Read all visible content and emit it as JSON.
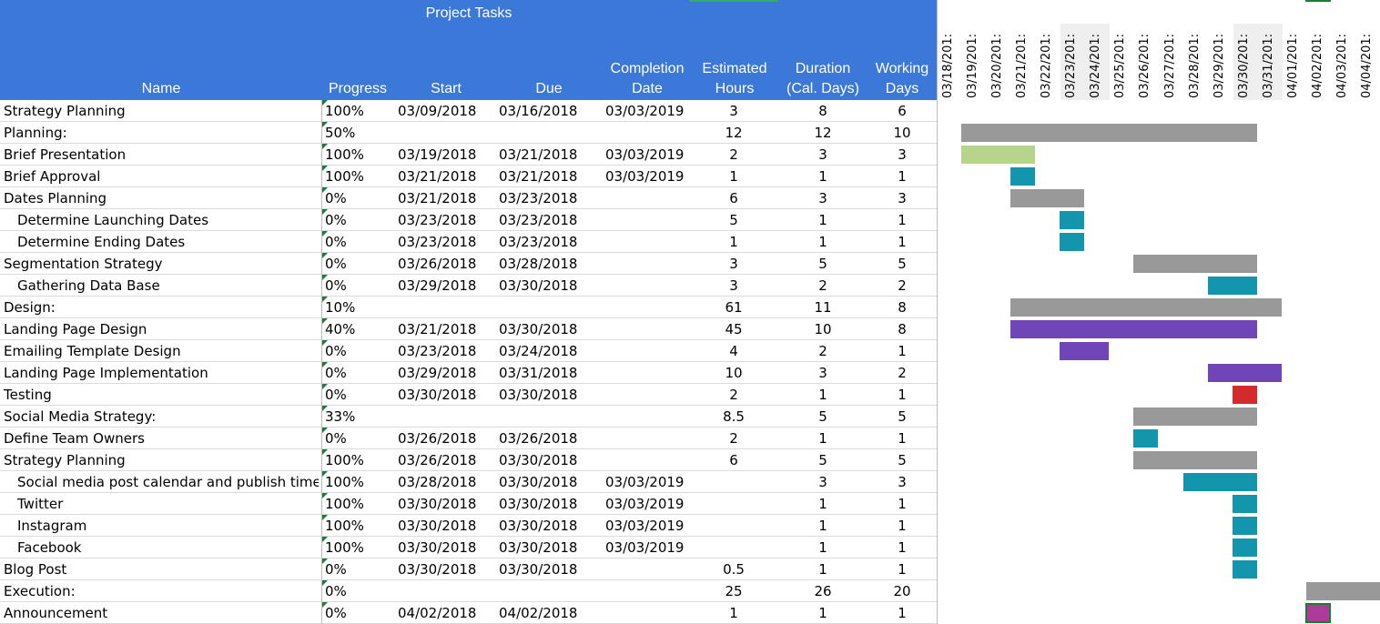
{
  "header": {
    "title": "Project Tasks",
    "columns": {
      "name": "Name",
      "progress": "Progress",
      "start": "Start",
      "due": "Due",
      "completion": "Completion\nDate",
      "estimated": "Estimated\nHours",
      "duration": "Duration\n(Cal. Days)",
      "working": "Working\nDays"
    },
    "colors": {
      "header_bg": "#3c78d8",
      "header_text": "#ffffff"
    }
  },
  "timeline": {
    "dates": [
      "03/18/201:",
      "03/19/201:",
      "03/20/201:",
      "03/21/201:",
      "03/22/201:",
      "03/23/201:",
      "03/24/201:",
      "03/25/201:",
      "03/26/201:",
      "03/27/201:",
      "03/28/201:",
      "03/29/201:",
      "03/30/201:",
      "03/31/201:",
      "04/01/201:",
      "04/02/201:",
      "04/03/201:",
      "04/04/201:"
    ],
    "weekend_shaded": [
      5,
      6,
      12,
      13
    ]
  },
  "tasks": [
    {
      "name": "Strategy Planning",
      "indent": 0,
      "progress": "100%",
      "start": "03/09/2018",
      "due": "03/16/2018",
      "completion": "03/03/2019",
      "est": "3",
      "dur": "8",
      "wd": "6",
      "bar": null
    },
    {
      "name": "Planning:",
      "indent": 0,
      "progress": "50%",
      "start": "",
      "due": "",
      "completion": "",
      "est": "12",
      "dur": "12",
      "wd": "10",
      "bar": {
        "from": 1,
        "span": 12,
        "color": "#999999"
      }
    },
    {
      "name": "Brief Presentation",
      "indent": 0,
      "progress": "100%",
      "start": "03/19/2018",
      "due": "03/21/2018",
      "completion": "03/03/2019",
      "est": "2",
      "dur": "3",
      "wd": "3",
      "bar": {
        "from": 1,
        "span": 3,
        "color": "#b6d48a"
      }
    },
    {
      "name": "Brief Approval",
      "indent": 0,
      "progress": "100%",
      "start": "03/21/2018",
      "due": "03/21/2018",
      "completion": "03/03/2019",
      "est": "1",
      "dur": "1",
      "wd": "1",
      "bar": {
        "from": 3,
        "span": 1,
        "color": "#1396ad"
      }
    },
    {
      "name": "Dates Planning",
      "indent": 0,
      "progress": "0%",
      "start": "03/21/2018",
      "due": "03/23/2018",
      "completion": "",
      "est": "6",
      "dur": "3",
      "wd": "3",
      "bar": {
        "from": 3,
        "span": 3,
        "color": "#999999"
      }
    },
    {
      "name": "Determine Launching Dates",
      "indent": 1,
      "progress": "0%",
      "start": "03/23/2018",
      "due": "03/23/2018",
      "completion": "",
      "est": "5",
      "dur": "1",
      "wd": "1",
      "bar": {
        "from": 5,
        "span": 1,
        "color": "#1396ad"
      }
    },
    {
      "name": "Determine Ending Dates",
      "indent": 1,
      "progress": "0%",
      "start": "03/23/2018",
      "due": "03/23/2018",
      "completion": "",
      "est": "1",
      "dur": "1",
      "wd": "1",
      "bar": {
        "from": 5,
        "span": 1,
        "color": "#1396ad"
      }
    },
    {
      "name": "Segmentation Strategy",
      "indent": 0,
      "progress": "0%",
      "start": "03/26/2018",
      "due": "03/28/2018",
      "completion": "",
      "est": "3",
      "dur": "5",
      "wd": "5",
      "bar": {
        "from": 8,
        "span": 5,
        "color": "#999999"
      }
    },
    {
      "name": "Gathering Data Base",
      "indent": 1,
      "progress": "0%",
      "start": "03/29/2018",
      "due": "03/30/2018",
      "completion": "",
      "est": "3",
      "dur": "2",
      "wd": "2",
      "bar": {
        "from": 11,
        "span": 2,
        "color": "#1396ad"
      }
    },
    {
      "name": "Design:",
      "indent": 0,
      "progress": "10%",
      "start": "",
      "due": "",
      "completion": "",
      "est": "61",
      "dur": "11",
      "wd": "8",
      "bar": {
        "from": 3,
        "span": 11,
        "color": "#999999"
      }
    },
    {
      "name": "Landing Page Design",
      "indent": 0,
      "progress": "40%",
      "start": "03/21/2018",
      "due": "03/30/2018",
      "completion": "",
      "est": "45",
      "dur": "10",
      "wd": "8",
      "bar": {
        "from": 3,
        "span": 10,
        "color": "#6f45b8"
      }
    },
    {
      "name": "Emailing Template Design",
      "indent": 0,
      "progress": "0%",
      "start": "03/23/2018",
      "due": "03/24/2018",
      "completion": "",
      "est": "4",
      "dur": "2",
      "wd": "1",
      "bar": {
        "from": 5,
        "span": 2,
        "color": "#6f45b8"
      }
    },
    {
      "name": "Landing Page Implementation",
      "indent": 0,
      "progress": "0%",
      "start": "03/29/2018",
      "due": "03/31/2018",
      "completion": "",
      "est": "10",
      "dur": "3",
      "wd": "2",
      "bar": {
        "from": 11,
        "span": 3,
        "color": "#6f45b8"
      }
    },
    {
      "name": "Testing",
      "indent": 0,
      "progress": "0%",
      "start": "03/30/2018",
      "due": "03/30/2018",
      "completion": "",
      "est": "2",
      "dur": "1",
      "wd": "1",
      "bar": {
        "from": 12,
        "span": 1,
        "color": "#d32b2b"
      }
    },
    {
      "name": "Social Media Strategy:",
      "indent": 0,
      "progress": "33%",
      "start": "",
      "due": "",
      "completion": "",
      "est": "8.5",
      "dur": "5",
      "wd": "5",
      "bar": {
        "from": 8,
        "span": 5,
        "color": "#999999"
      }
    },
    {
      "name": "Define Team Owners",
      "indent": 0,
      "progress": "0%",
      "start": "03/26/2018",
      "due": "03/26/2018",
      "completion": "",
      "est": "2",
      "dur": "1",
      "wd": "1",
      "bar": {
        "from": 8,
        "span": 1,
        "color": "#1396ad"
      }
    },
    {
      "name": "Strategy Planning",
      "indent": 0,
      "progress": "100%",
      "start": "03/26/2018",
      "due": "03/30/2018",
      "completion": "",
      "est": "6",
      "dur": "5",
      "wd": "5",
      "bar": {
        "from": 8,
        "span": 5,
        "color": "#999999"
      }
    },
    {
      "name": "Social media post calendar and publish time",
      "indent": 1,
      "progress": "100%",
      "start": "03/28/2018",
      "due": "03/30/2018",
      "completion": "03/03/2019",
      "est": "",
      "dur": "3",
      "wd": "3",
      "bar": {
        "from": 10,
        "span": 3,
        "color": "#1396ad"
      }
    },
    {
      "name": "Twitter",
      "indent": 1,
      "progress": "100%",
      "start": "03/30/2018",
      "due": "03/30/2018",
      "completion": "03/03/2019",
      "est": "",
      "dur": "1",
      "wd": "1",
      "bar": {
        "from": 12,
        "span": 1,
        "color": "#1396ad"
      }
    },
    {
      "name": "Instagram",
      "indent": 1,
      "progress": "100%",
      "start": "03/30/2018",
      "due": "03/30/2018",
      "completion": "03/03/2019",
      "est": "",
      "dur": "1",
      "wd": "1",
      "bar": {
        "from": 12,
        "span": 1,
        "color": "#1396ad"
      }
    },
    {
      "name": "Facebook",
      "indent": 1,
      "progress": "100%",
      "start": "03/30/2018",
      "due": "03/30/2018",
      "completion": "03/03/2019",
      "est": "",
      "dur": "1",
      "wd": "1",
      "bar": {
        "from": 12,
        "span": 1,
        "color": "#1396ad"
      }
    },
    {
      "name": "Blog Post",
      "indent": 0,
      "progress": "0%",
      "start": "03/30/2018",
      "due": "03/30/2018",
      "completion": "",
      "est": "0.5",
      "dur": "1",
      "wd": "1",
      "bar": {
        "from": 12,
        "span": 1,
        "color": "#1396ad"
      }
    },
    {
      "name": "Execution:",
      "indent": 0,
      "progress": "0%",
      "start": "",
      "due": "",
      "completion": "",
      "est": "25",
      "dur": "26",
      "wd": "20",
      "bar": {
        "from": 15,
        "span": 3,
        "color": "#999999"
      }
    },
    {
      "name": "Announcement",
      "indent": 0,
      "progress": "0%",
      "start": "04/02/2018",
      "due": "04/02/2018",
      "completion": "",
      "est": "1",
      "dur": "1",
      "wd": "1",
      "bar": {
        "from": 15,
        "span": 1,
        "color": "#b03a9a",
        "selected": true
      }
    }
  ]
}
